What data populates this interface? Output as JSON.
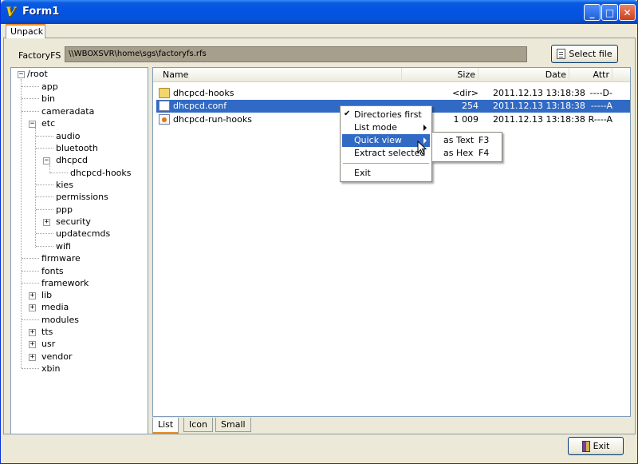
{
  "window": {
    "title": "Form1",
    "controls": {
      "minimize": "_",
      "maximize": "□",
      "close": "✕"
    }
  },
  "top_tab": {
    "label": "Unpack"
  },
  "path_bar": {
    "label": "FactoryFS :",
    "value": "\\\\WBOXSVR\\home\\sgs\\factoryfs.rfs",
    "select_button": "Select file"
  },
  "tree": {
    "items": [
      {
        "label": "/root",
        "expander": "−"
      },
      {
        "label": "app"
      },
      {
        "label": "bin"
      },
      {
        "label": "cameradata"
      },
      {
        "label": "etc",
        "expander": "−"
      },
      {
        "label": "audio"
      },
      {
        "label": "bluetooth"
      },
      {
        "label": "dhcpcd",
        "expander": "−"
      },
      {
        "label": "dhcpcd-hooks"
      },
      {
        "label": "kies"
      },
      {
        "label": "permissions"
      },
      {
        "label": "ppp"
      },
      {
        "label": "security",
        "expander": "+"
      },
      {
        "label": "updatecmds"
      },
      {
        "label": "wifi"
      },
      {
        "label": "firmware"
      },
      {
        "label": "fonts"
      },
      {
        "label": "framework"
      },
      {
        "label": "lib",
        "expander": "+"
      },
      {
        "label": "media",
        "expander": "+"
      },
      {
        "label": "modules"
      },
      {
        "label": "tts",
        "expander": "+"
      },
      {
        "label": "usr",
        "expander": "+"
      },
      {
        "label": "vendor",
        "expander": "+"
      },
      {
        "label": "xbin"
      }
    ]
  },
  "file_list": {
    "columns": {
      "name": "Name",
      "size": "Size",
      "date": "Date",
      "attr": "Attr"
    },
    "rows": [
      {
        "name": "dhcpcd-hooks",
        "size": "<dir>",
        "date": "2011.12.13 13:18:38",
        "attr": "----D-",
        "icon": "folder-icon"
      },
      {
        "name": "dhcpcd.conf",
        "size": "254",
        "date": "2011.12.13 13:18:38",
        "attr": "-----A",
        "icon": "file-icon",
        "selected": true
      },
      {
        "name": "dhcpcd-run-hooks",
        "size": "1 009",
        "date": "2011.12.13 13:18:38",
        "attr": "R----A",
        "icon": "executable-icon"
      }
    ]
  },
  "context_menu": {
    "items": {
      "directories_first": "Directories first",
      "check_mark": "✔",
      "list_mode": "List mode",
      "quick_view": "Quick view",
      "extract_selected": "Extract selected",
      "exit": "Exit"
    }
  },
  "submenu": {
    "as_text": "as Text",
    "as_text_shortcut": "F3",
    "as_hex": "as Hex",
    "as_hex_shortcut": "F4"
  },
  "bottom_tabs": {
    "list": "List",
    "icon": "Icon",
    "small": "Small"
  },
  "exit_button": {
    "label": "Exit"
  },
  "colors": {
    "titlebar": "#0554e3",
    "selection": "#316ac5",
    "face": "#ece9d8",
    "path_field": "#a59f8c"
  }
}
